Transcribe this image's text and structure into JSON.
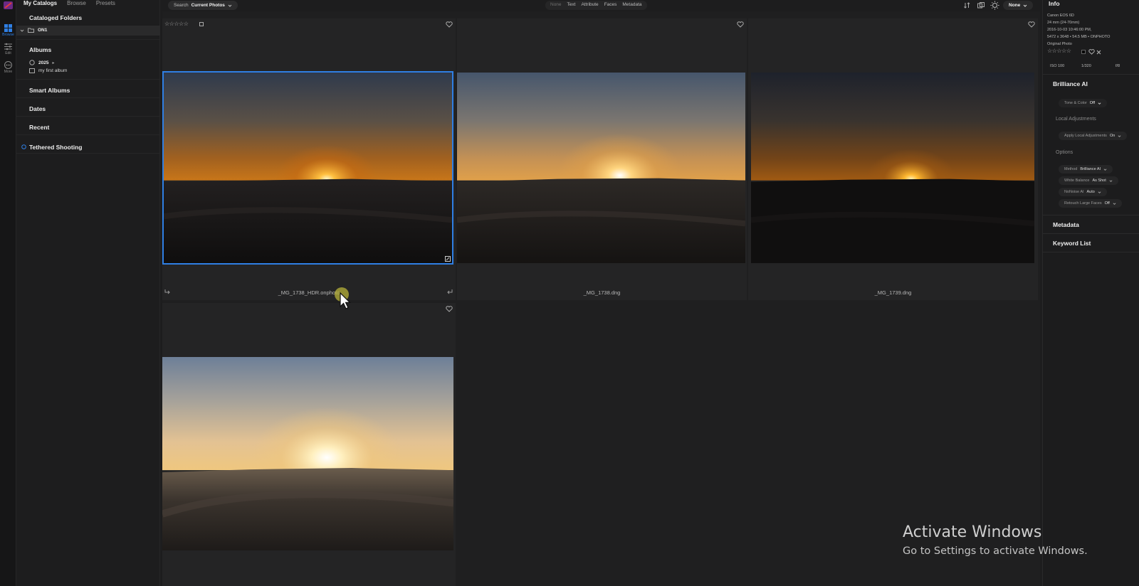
{
  "left_tabs": [
    "My Catalogs",
    "Browse",
    "Presets"
  ],
  "rail": [
    {
      "label": "Browse",
      "icon": "grid-icon"
    },
    {
      "label": "Edit",
      "icon": "sliders-icon"
    },
    {
      "label": "More",
      "icon": "more-icon"
    }
  ],
  "catalog": {
    "cataloged_folders": "Cataloged Folders",
    "folder": "ON1",
    "albums": "Albums",
    "album_items": [
      "2025",
      "my first album"
    ],
    "smart_albums": "Smart Albums",
    "dates": "Dates",
    "recent": "Recent",
    "tethered": "Tethered Shooting"
  },
  "topbar": {
    "search_label": "Search",
    "search_scope": "Current Photos",
    "filters": [
      "None",
      "Text",
      "Attribute",
      "Faces",
      "Metadata"
    ],
    "sort_value": "None"
  },
  "photos": [
    {
      "name": "_MG_1738_HDR.onphoto",
      "selected": true
    },
    {
      "name": "_MG_1738.dng",
      "selected": false
    },
    {
      "name": "_MG_1739.dng",
      "selected": false
    },
    {
      "name": "",
      "selected": false
    }
  ],
  "info": {
    "title": "Info",
    "camera": "Canon EOS 6D",
    "lens": "24 mm (24-70mm)",
    "date": "2016-10-03 10:46:00 PM,",
    "dims": "5472 x 3648  •  54.5 MB  •  ONPHOTO",
    "kind": "Original Photo",
    "iso": "ISO 100",
    "shutter": "1/320",
    "aperture": "f/8"
  },
  "brilliance": {
    "title": "Brilliance AI",
    "tone_label": "Tone & Color",
    "tone_value": "Off",
    "local_adj": "Local Adjustments",
    "apply_label": "Apply Local Adjustments",
    "apply_value": "On",
    "options": "Options",
    "method_label": "Method",
    "method_value": "Brilliance AI",
    "wb_label": "White Balance",
    "wb_value": "As Shot",
    "noise_label": "NoNoise AI",
    "noise_value": "Auto",
    "retouch_label": "Retouch Large Faces",
    "retouch_value": "Off"
  },
  "metadata_title": "Metadata",
  "keyword_title": "Keyword List",
  "watermark": {
    "line1": "Activate Windows",
    "line2": "Go to Settings to activate Windows."
  },
  "colors": {
    "accent": "#2f7fe4",
    "bg": "#1d1d1e"
  }
}
